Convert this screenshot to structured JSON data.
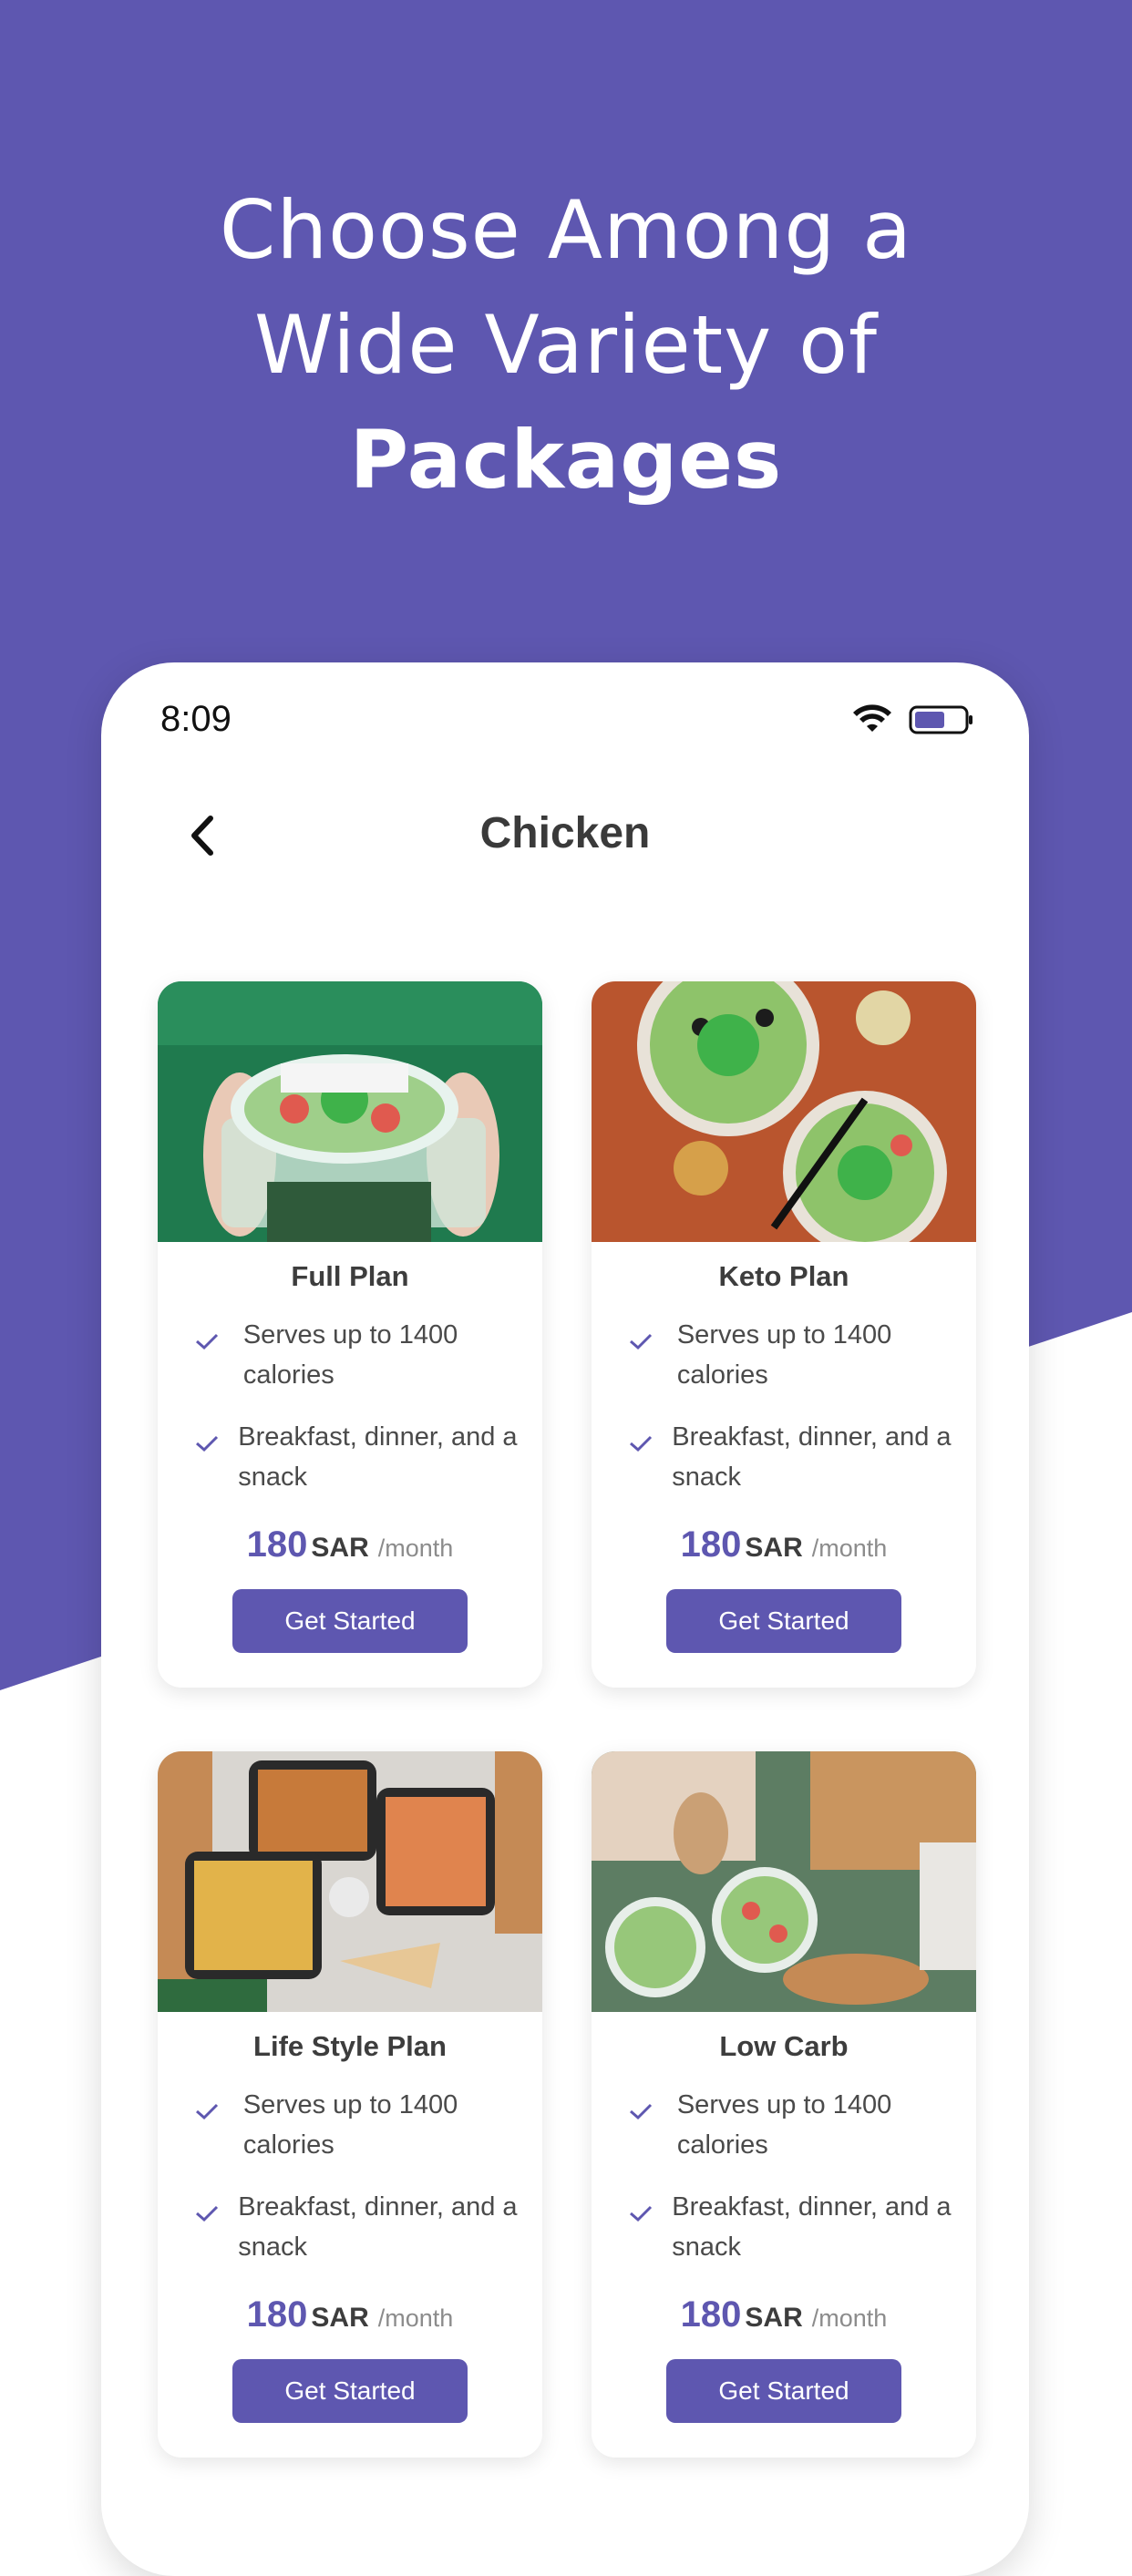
{
  "headline": {
    "line1": "Choose Among a",
    "line2": "Wide Variety of",
    "line3": "Packages"
  },
  "status_bar": {
    "time": "8:09",
    "wifi_icon": "wifi-icon",
    "battery_icon": "battery-icon"
  },
  "header": {
    "back_icon": "chevron-left-icon",
    "title": "Chicken"
  },
  "plans": [
    {
      "title": "Full Plan",
      "features": [
        "Serves up to 1400 calories",
        "Breakfast, dinner, and a snack"
      ],
      "price": "180",
      "currency": "SAR",
      "period": "/month",
      "button": "Get Started"
    },
    {
      "title": "Keto Plan",
      "features": [
        "Serves up to 1400 calories",
        "Breakfast, dinner, and a snack"
      ],
      "price": "180",
      "currency": "SAR",
      "period": "/month",
      "button": "Get Started"
    },
    {
      "title": "Life Style Plan",
      "features": [
        "Serves up to 1400 calories",
        "Breakfast, dinner, and a snack"
      ],
      "price": "180",
      "currency": "SAR",
      "period": "/month",
      "button": "Get Started"
    },
    {
      "title": "Low Carb",
      "features": [
        "Serves up to 1400 calories",
        "Breakfast, dinner, and a snack"
      ],
      "price": "180",
      "currency": "SAR",
      "period": "/month",
      "button": "Get Started"
    }
  ],
  "colors": {
    "brand": "#5e57b0",
    "check": "#5e57b0"
  }
}
